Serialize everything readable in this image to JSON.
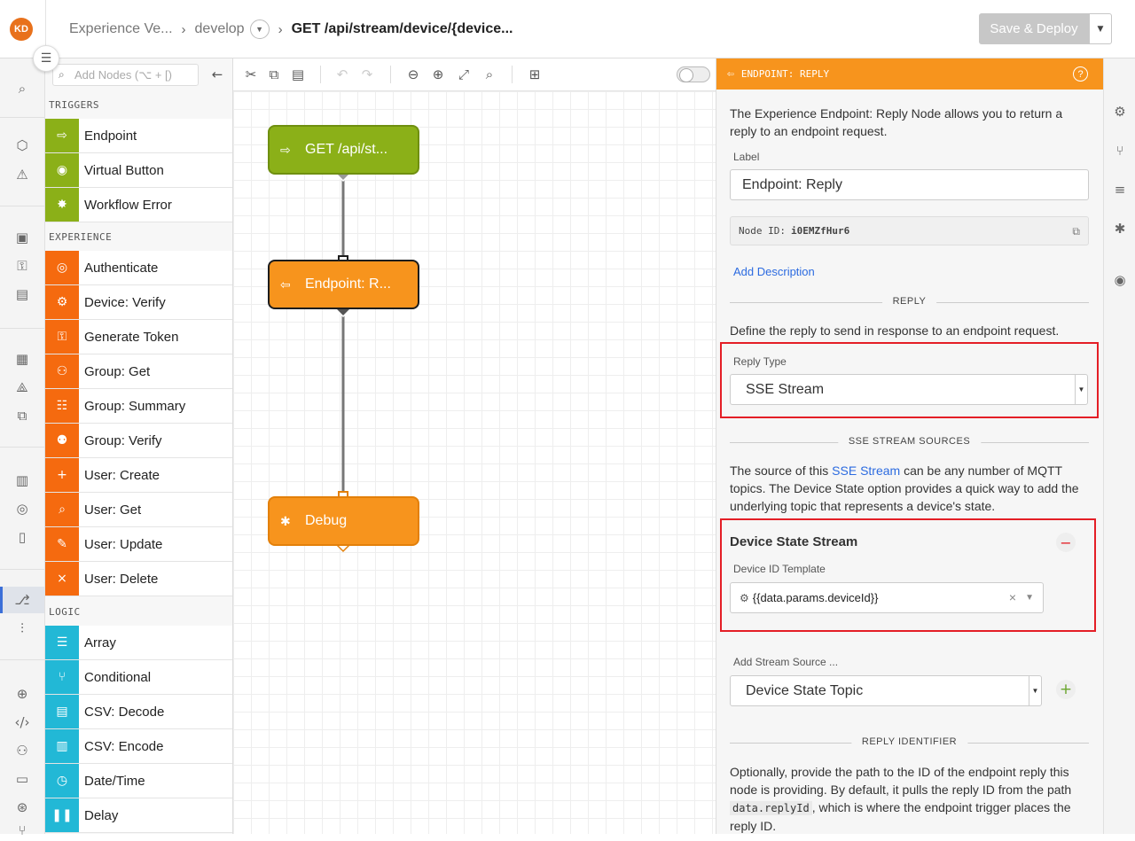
{
  "header": {
    "avatar": "KD",
    "crumb_app": "Experience Ve...",
    "crumb_version": "develop",
    "crumb_current": "GET /api/stream/device/{device...",
    "save_label": "Save & Deploy"
  },
  "palette": {
    "search_placeholder": "Add Nodes (⌥ + [)",
    "sections": {
      "triggers": "TRIGGERS",
      "experience": "EXPERIENCE",
      "logic": "LOGIC"
    },
    "triggers": [
      {
        "label": "Endpoint",
        "icon": "endpoint-icon"
      },
      {
        "label": "Virtual Button",
        "icon": "virtual-button-icon"
      },
      {
        "label": "Workflow Error",
        "icon": "workflow-error-icon"
      }
    ],
    "experience": [
      {
        "label": "Authenticate",
        "icon": "fingerprint-icon"
      },
      {
        "label": "Device: Verify",
        "icon": "device-verify-icon"
      },
      {
        "label": "Generate Token",
        "icon": "key-icon"
      },
      {
        "label": "Group: Get",
        "icon": "group-get-icon"
      },
      {
        "label": "Group: Summary",
        "icon": "group-summary-icon"
      },
      {
        "label": "Group: Verify",
        "icon": "group-verify-icon"
      },
      {
        "label": "User: Create",
        "icon": "user-create-icon"
      },
      {
        "label": "User: Get",
        "icon": "user-get-icon"
      },
      {
        "label": "User: Update",
        "icon": "user-update-icon"
      },
      {
        "label": "User: Delete",
        "icon": "user-delete-icon"
      }
    ],
    "logic": [
      {
        "label": "Array",
        "icon": "list-icon"
      },
      {
        "label": "Conditional",
        "icon": "conditional-icon"
      },
      {
        "label": "CSV: Decode",
        "icon": "csv-decode-icon"
      },
      {
        "label": "CSV: Encode",
        "icon": "csv-encode-icon"
      },
      {
        "label": "Date/Time",
        "icon": "clock-icon"
      },
      {
        "label": "Delay",
        "icon": "pause-icon"
      }
    ]
  },
  "canvas": {
    "nodes": [
      {
        "label": "GET /api/st...",
        "icon": "endpoint-icon",
        "color": "#8bb018"
      },
      {
        "label": "Endpoint: R...",
        "icon": "endpoint-reply-icon",
        "color": "#f7941d"
      },
      {
        "label": "Debug",
        "icon": "bug-icon",
        "color": "#f7941d"
      }
    ]
  },
  "panel": {
    "title": "ENDPOINT: REPLY",
    "intro": "The Experience Endpoint: Reply Node allows you to return a reply to an endpoint request.",
    "label_caption": "Label",
    "label_value": "Endpoint: Reply",
    "node_id_caption": "Node ID:",
    "node_id": "i0EMZfHur6",
    "add_description": "Add Description",
    "reply_heading": "REPLY",
    "reply_text": "Define the reply to send in response to an endpoint request.",
    "reply_type_caption": "Reply Type",
    "reply_type_value": "SSE Stream",
    "sources_heading": "SSE STREAM SOURCES",
    "sources_text_1": "The source of this ",
    "sources_link": "SSE Stream",
    "sources_text_2": " can be any number of MQTT topics. The Device State option provides a quick way to add the underlying topic that represents a device's state.",
    "dss_title": "Device State Stream",
    "device_id_caption": "Device ID Template",
    "device_id_value": "{{data.params.deviceId}}",
    "add_source_caption": "Add Stream Source ...",
    "add_source_value": "Device State Topic",
    "identifier_heading": "REPLY IDENTIFIER",
    "identifier_text_1": "Optionally, provide the path to the ID of the endpoint reply this node is providing. By default, it pulls the reply ID from the path ",
    "identifier_code": "data.replyId",
    "identifier_text_2": ", which is where the endpoint trigger places the reply ID."
  },
  "colors": {
    "accent": "#f7941d",
    "trigger": "#8bb018",
    "experience": "#f56a0f",
    "logic": "#22b8d6",
    "highlight": "#e41e26"
  }
}
